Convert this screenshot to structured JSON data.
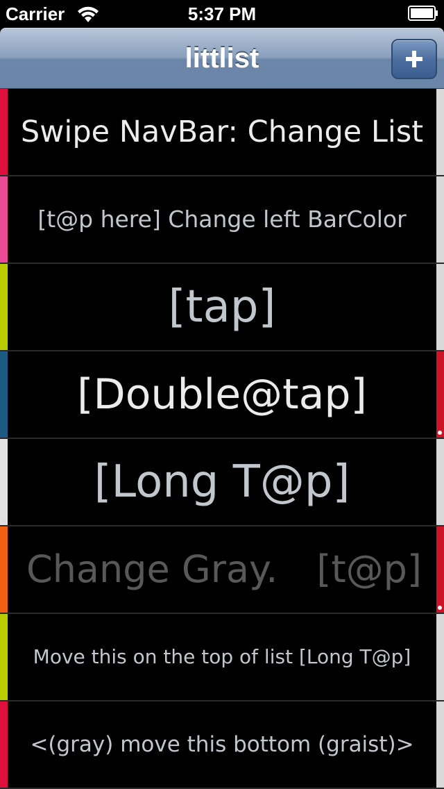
{
  "status_bar": {
    "carrier": "Carrier",
    "time": "5:37 PM",
    "wifi_icon": "wifi-icon",
    "battery_icon": "battery-full-icon"
  },
  "nav_bar": {
    "title": "littlist",
    "add_button_icon": "plus-icon"
  },
  "rows": [
    {
      "text": "Swipe NavBar: Change List",
      "left_bar_color": "#e0103e",
      "right_bar_color": "#d9d9d9",
      "text_color": "#ececec"
    },
    {
      "text": "[t@p here] Change left BarColor",
      "left_bar_color": "#e94b96",
      "right_bar_color": "#d9d9d9",
      "text_color": "#c2c7ce"
    },
    {
      "text": "[tap]",
      "left_bar_color": "#b9cc00",
      "right_bar_color": "#d9d9d9",
      "text_color": "#c2c7ce"
    },
    {
      "text": "[Double@tap]",
      "left_bar_color": "#1c5a84",
      "right_bar_color": "#cc1427",
      "text_color": "#ececec"
    },
    {
      "text": "[Long T@p]",
      "left_bar_color": "#e2e2e2",
      "right_bar_color": "#d9d9d9",
      "text_color": "#c2c7ce"
    },
    {
      "text": "Change Gray.",
      "text_2": "[t@p]",
      "left_bar_color": "#f06013",
      "right_bar_color": "#cc1427",
      "text_color": "#585858"
    },
    {
      "text": "Move this on the top of list [Long T@p]",
      "left_bar_color": "#b9cc00",
      "right_bar_color": "#d9d9d9",
      "text_color": "#c2c7ce"
    },
    {
      "text": "<(gray) move this bottom (graist)>",
      "left_bar_color": "#e0103e",
      "right_bar_color": "#d9d9d9",
      "text_color": "#c2c7ce"
    }
  ]
}
